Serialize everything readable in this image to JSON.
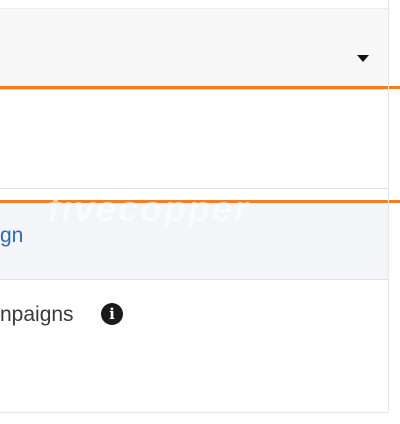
{
  "dropdown": {
    "icon": "caret-down-icon"
  },
  "link_row": {
    "label": "gn"
  },
  "campaigns_row": {
    "label": "npaigns",
    "icon": "info-icon",
    "icon_glyph": "i"
  },
  "watermark": {
    "text": "fivecopper"
  },
  "colors": {
    "accent_orange": "#f57c20",
    "link_blue": "#2a6bb8"
  }
}
